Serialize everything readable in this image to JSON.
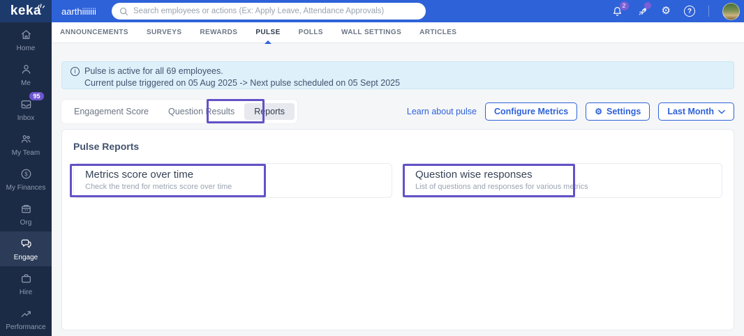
{
  "brand": {
    "logo_text": "keka"
  },
  "header": {
    "username": "aarthiiiiiii",
    "search_placeholder": "Search employees or actions (Ex: Apply Leave, Attendance Approvals)",
    "notification_count": "2",
    "icons": [
      "bell-icon",
      "rocket-icon",
      "gear-icon",
      "help-icon",
      "avatar"
    ]
  },
  "top_tabs": {
    "active": "PULSE",
    "items": [
      {
        "label": "ANNOUNCEMENTS"
      },
      {
        "label": "SURVEYS"
      },
      {
        "label": "REWARDS"
      },
      {
        "label": "PULSE"
      },
      {
        "label": "POLLS"
      },
      {
        "label": "WALL SETTINGS"
      },
      {
        "label": "ARTICLES"
      }
    ]
  },
  "sidebar": {
    "active": "Engage",
    "items": [
      {
        "label": "Home",
        "icon": "home-icon"
      },
      {
        "label": "Me",
        "icon": "user-icon"
      },
      {
        "label": "Inbox",
        "icon": "inbox-icon",
        "badge": "95"
      },
      {
        "label": "My Team",
        "icon": "team-icon"
      },
      {
        "label": "My Finances",
        "icon": "finances-icon"
      },
      {
        "label": "Org",
        "icon": "org-icon"
      },
      {
        "label": "Engage",
        "icon": "engage-icon"
      },
      {
        "label": "Hire",
        "icon": "hire-icon"
      },
      {
        "label": "Performance",
        "icon": "performance-icon"
      }
    ]
  },
  "banner": {
    "line1": "Pulse is active for all 69 employees.",
    "line2": "Current pulse triggered on 05 Aug 2025 -> Next pulse scheduled on 05 Sept 2025"
  },
  "pulse_tabs": {
    "active": "Reports",
    "items": [
      {
        "label": "Engagement Score"
      },
      {
        "label": "Question Results"
      },
      {
        "label": "Reports"
      }
    ]
  },
  "actions": {
    "learn_link": "Learn about pulse",
    "configure_button": "Configure Metrics",
    "settings_button": "Settings",
    "period_dropdown": "Last Month"
  },
  "reports": {
    "section_title": "Pulse Reports",
    "cards": [
      {
        "title": "Metrics score over time",
        "subtitle": "Check the trend for metrics score over time"
      },
      {
        "title": "Question wise responses",
        "subtitle": "List of questions and responses for various metrics"
      }
    ]
  },
  "colors": {
    "header_blue": "#2e62d9",
    "logo_navy": "#1d3a6d",
    "sidebar_navy": "#1c2b45",
    "banner_blue": "#def0fa",
    "annotation_purple": "#6352c6",
    "badge_purple": "#7a5fd6",
    "link_blue": "#2e62d9"
  }
}
